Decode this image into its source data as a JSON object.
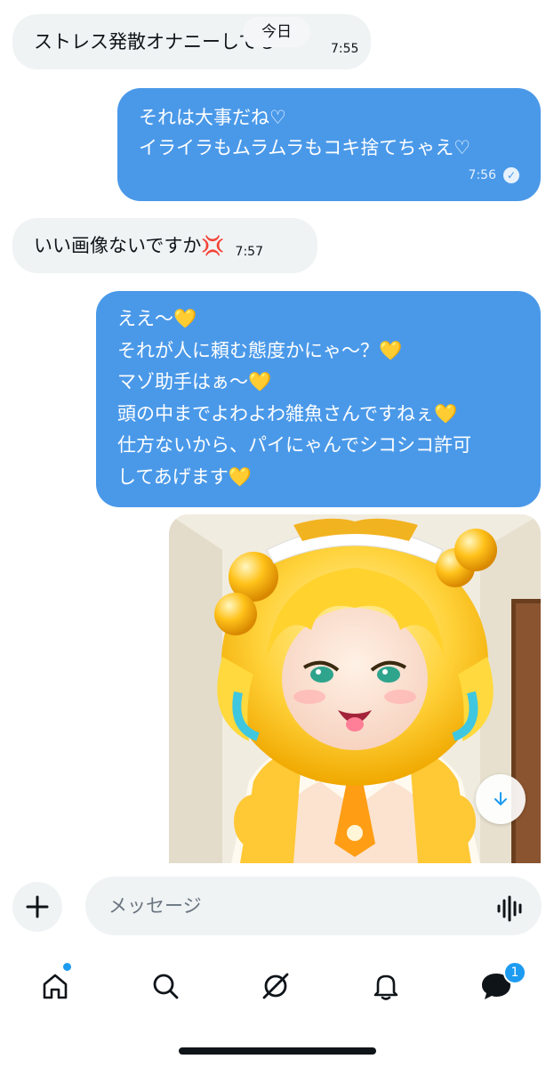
{
  "date_divider": "今日",
  "messages": [
    {
      "id": "m1",
      "direction": "in",
      "text": "ストレス発散オナニーしてる",
      "time": "7:55"
    },
    {
      "id": "m2",
      "direction": "out",
      "text": "それは大事だね♡\nイライラもムラムラもコキ捨てちゃえ♡",
      "time": "7:56",
      "read": true
    },
    {
      "id": "m3",
      "direction": "in",
      "text": "いい画像ないですか💢",
      "time": "7:57"
    },
    {
      "id": "m4",
      "direction": "out",
      "text": "ええ〜💛\nそれが人に頼む態度かにゃ〜？💛\nマゾ助手はぁ〜💛\n頭の中までよわよわ雑魚さんですねぇ💛\n仕方ないから、パイにゃんでシコシコ許可\nしてあげます💛"
    },
    {
      "id": "m5",
      "direction": "out",
      "type": "image",
      "content": "anime-illustration"
    }
  ],
  "compose": {
    "placeholder": "メッセージ",
    "add_icon": "plus-icon",
    "voice_icon": "waveform-icon"
  },
  "tabs": [
    {
      "name": "home",
      "icon": "home-icon",
      "notification_dot": true
    },
    {
      "name": "search",
      "icon": "search-icon"
    },
    {
      "name": "grok",
      "icon": "grok-icon"
    },
    {
      "name": "notifications",
      "icon": "bell-icon"
    },
    {
      "name": "messages",
      "icon": "messages-icon",
      "badge": "1",
      "active": true
    }
  ],
  "colors": {
    "accent": "#1d9bf0",
    "bubble_out": "#4a99e9",
    "bubble_in": "#eff3f4"
  }
}
